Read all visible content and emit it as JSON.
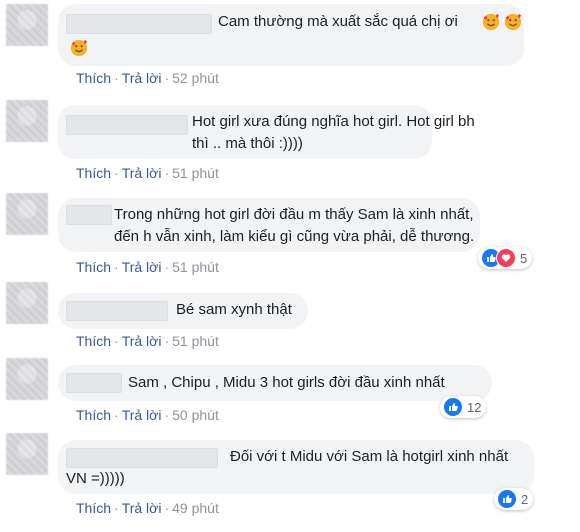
{
  "actions": {
    "like": "Thích",
    "reply": "Trả lời",
    "separator": "·"
  },
  "colors": {
    "bubble": "#f2f3f5",
    "link": "#385898",
    "like_blue": "#1877f2",
    "love_red": "#f33e58",
    "haha_yellow": "#f7b125"
  },
  "comments": [
    {
      "text_lines": [
        "Cam thường mà xuất sắc quá chị ơi",
        ""
      ],
      "emoji": "smiling-face-with-hearts-icon",
      "time": "52 phút",
      "reactions": null
    },
    {
      "text_lines": [
        "Hot girl xưa đúng nghĩa hot girl. Hot girl bh",
        "thì .. mà thôi :))))"
      ],
      "time": "51 phút",
      "reactions": null
    },
    {
      "text_lines": [
        "Trong những hot girl đời đầu m thấy Sam là xinh nhất,",
        "đến h vẫn xinh, làm kiểu gì cũng vừa phải, dễ thương."
      ],
      "time": "51 phút",
      "reactions": {
        "icons": [
          "like-icon",
          "love-icon"
        ],
        "count": "5"
      }
    },
    {
      "text_lines": [
        "Bé sam xynh thật"
      ],
      "time": "51 phút",
      "reactions": null
    },
    {
      "text_lines": [
        "Sam , Chipu , Midu 3 hot girls đời đầu xinh nhất"
      ],
      "time": "50 phút",
      "reactions": {
        "icons": [
          "like-icon"
        ],
        "count": "12"
      }
    },
    {
      "text_lines": [
        "Đối với t Midu với Sam là hotgirl xinh nhất",
        "VN =)))))"
      ],
      "time": "49 phút",
      "reactions": {
        "icons": [
          "like-icon"
        ],
        "count": "2"
      }
    }
  ]
}
